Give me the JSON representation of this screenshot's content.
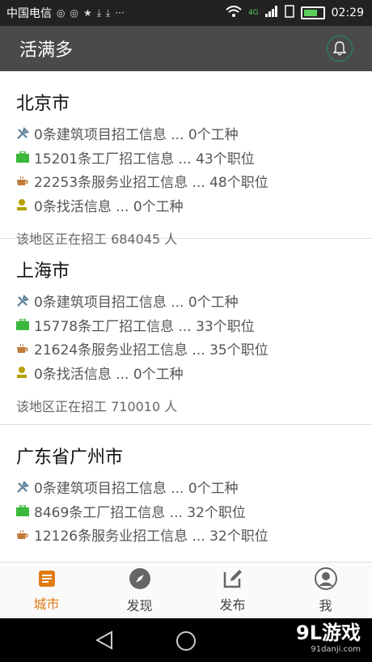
{
  "status": {
    "carrier": "中国电信",
    "time": "02:29",
    "net": "4G"
  },
  "app": {
    "title": "活满多"
  },
  "cards": [
    {
      "city": "北京市",
      "rows": [
        "0条建筑项目招工信息 ... 0个工种",
        "15201条工厂招工信息 ... 43个职位",
        "22253条服务业招工信息 ... 48个职位",
        "0条找活信息 ... 0个工种"
      ],
      "summary": "该地区正在招工 684045 人"
    },
    {
      "city": "上海市",
      "rows": [
        "0条建筑项目招工信息 ... 0个工种",
        "15778条工厂招工信息 ... 33个职位",
        "21624条服务业招工信息 ... 35个职位",
        "0条找活信息 ... 0个工种"
      ],
      "summary": "该地区正在招工 710010 人"
    },
    {
      "city": "广东省广州市",
      "rows": [
        "0条建筑项目招工信息 ... 0个工种",
        "8469条工厂招工信息 ... 32个职位",
        "12126条服务业招工信息 ... 32个职位"
      ]
    }
  ],
  "tabs": [
    {
      "label": "城市",
      "icon": "document-icon",
      "active": true
    },
    {
      "label": "发现",
      "icon": "compass-icon",
      "active": false
    },
    {
      "label": "发布",
      "icon": "edit-icon",
      "active": false
    },
    {
      "label": "我",
      "icon": "person-icon",
      "active": false
    }
  ],
  "watermark": {
    "brand": "9L游戏",
    "site": "91danji.com"
  },
  "colors": {
    "accent": "#e07b12",
    "appbar": "#4a4a4a",
    "bell_ring": "#1f8e6a",
    "factory_icon": "#3cb83c",
    "service_icon": "#c07a3a",
    "worker_icon": "#b5a000",
    "tools_icon": "#5a7f9a"
  }
}
